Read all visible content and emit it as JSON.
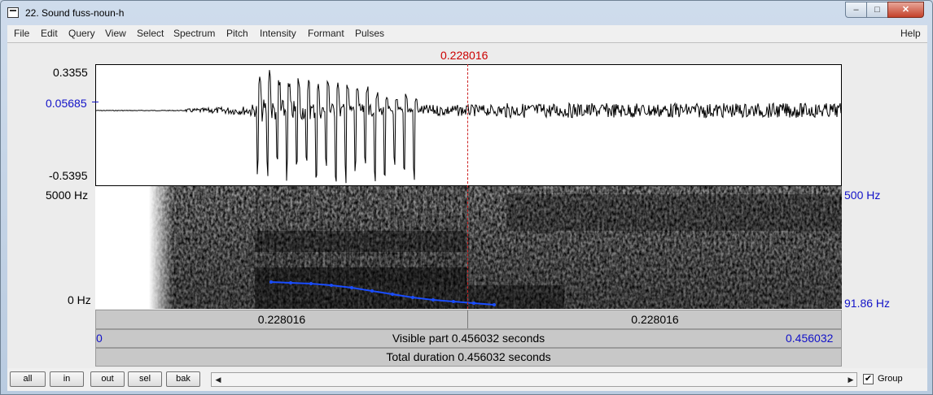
{
  "window": {
    "title": "22. Sound fuss-noun-h",
    "min_label": "–",
    "max_label": "□",
    "close_label": "✕"
  },
  "menu": {
    "items": [
      "File",
      "Edit",
      "Query",
      "View",
      "Select",
      "Spectrum",
      "Pitch",
      "Intensity",
      "Formant",
      "Pulses"
    ],
    "help": "Help"
  },
  "cursor": {
    "time_label": "0.228016"
  },
  "waveform": {
    "max_label": "0.3355",
    "cursor_value": "0.05685",
    "min_label": "-0.5395"
  },
  "spectrogram": {
    "top_freq": "5000 Hz",
    "bottom_freq": "0 Hz",
    "pitch_top": "500 Hz",
    "pitch_bottom": "91.86 Hz"
  },
  "bars": {
    "left_part": "0.228016",
    "right_part": "0.228016",
    "visible_start": "0",
    "visible_label": "Visible part 0.456032 seconds",
    "visible_end": "0.456032",
    "total_label": "Total duration 0.456032 seconds"
  },
  "buttons": {
    "all": "all",
    "in": "in",
    "out": "out",
    "sel": "sel",
    "bak": "bak"
  },
  "scroll": {
    "left_arrow": "◀",
    "right_arrow": "▶"
  },
  "group": {
    "checked": true,
    "check_mark": "✔",
    "label": "Group"
  },
  "colors": {
    "cursor": "#cc0000",
    "pitch": "#1a4dff",
    "axis_blue": "#1212c8"
  }
}
